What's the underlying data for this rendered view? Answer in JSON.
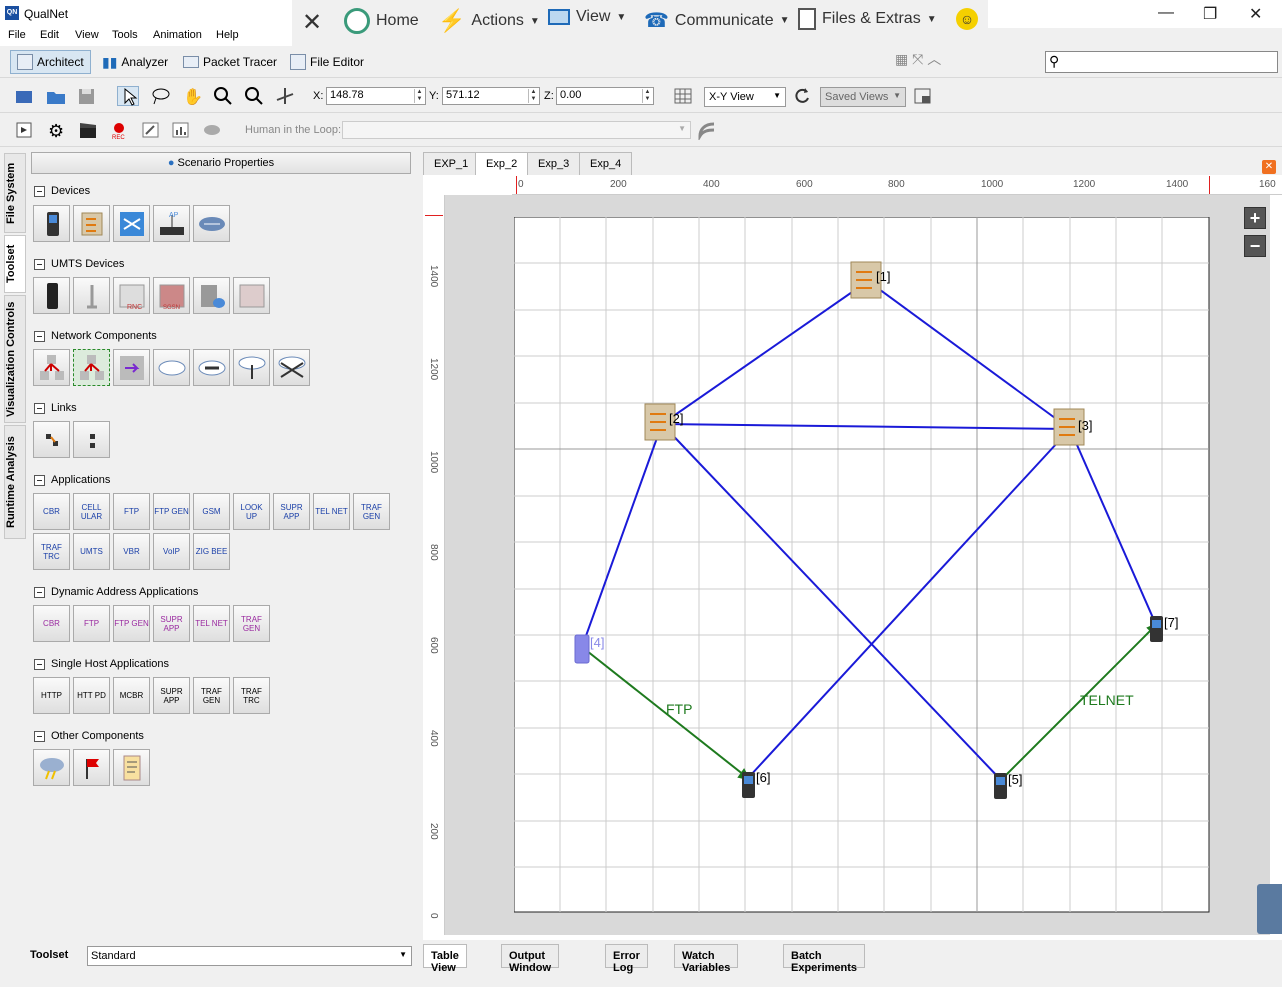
{
  "app": {
    "title": "QualNet"
  },
  "menu": [
    "File",
    "Edit",
    "View",
    "Tools",
    "Animation",
    "Help"
  ],
  "ribbon": {
    "home": "Home",
    "actions": "Actions",
    "view": "View",
    "communicate": "Communicate",
    "files": "Files & Extras"
  },
  "modes": [
    "Architect",
    "Analyzer",
    "Packet Tracer",
    "File Editor"
  ],
  "coords": {
    "x_label": "X:",
    "x": "148.78",
    "y_label": "Y:",
    "y": "571.12",
    "z_label": "Z:",
    "z": "0.00"
  },
  "view_select": "X-Y View",
  "saved_views": "Saved Views",
  "hitl_label": "Human in the Loop:",
  "side_tabs": [
    "File System",
    "Toolset",
    "Visualization Controls",
    "Runtime Analysis"
  ],
  "scenario_properties": "Scenario Properties",
  "sections": {
    "devices": "Devices",
    "umts": "UMTS Devices",
    "network": "Network Components",
    "links": "Links",
    "applications": "Applications",
    "dynamic": "Dynamic Address Applications",
    "single": "Single Host Applications",
    "other": "Other Components"
  },
  "umts_tile_labels": [
    "RNC",
    "SGSN"
  ],
  "applications": [
    "CBR",
    "CELL ULAR",
    "FTP",
    "FTP GEN",
    "GSM",
    "LOOK UP",
    "SUPR APP",
    "TEL NET",
    "TRAF GEN",
    "TRAF TRC",
    "UMTS",
    "VBR",
    "VoIP",
    "ZIG BEE"
  ],
  "dynamic_apps": [
    "CBR",
    "FTP",
    "FTP GEN",
    "SUPR APP",
    "TEL NET",
    "TRAF GEN"
  ],
  "single_host_apps": [
    "HTTP",
    "HTT PD",
    "MCBR",
    "SUPR APP",
    "TRAF GEN",
    "TRAF TRC"
  ],
  "toolset": {
    "label": "Toolset",
    "value": "Standard"
  },
  "exp_tabs": [
    "EXP_1",
    "Exp_2",
    "Exp_3",
    "Exp_4"
  ],
  "ruler_x": [
    "0",
    "200",
    "400",
    "600",
    "800",
    "1000",
    "1200",
    "1400",
    "160"
  ],
  "ruler_y": [
    "1400",
    "1200",
    "1000",
    "800",
    "600",
    "400",
    "200",
    "0"
  ],
  "bottom_tabs": [
    "Table View",
    "Output Window",
    "Error Log",
    "Watch Variables",
    "Batch Experiments"
  ],
  "nodes": [
    {
      "id": "[1]",
      "type": "router"
    },
    {
      "id": "[2]",
      "type": "router"
    },
    {
      "id": "[3]",
      "type": "router"
    },
    {
      "id": "[4]",
      "type": "phone-selected"
    },
    {
      "id": "[5]",
      "type": "phone"
    },
    {
      "id": "[6]",
      "type": "phone"
    },
    {
      "id": "[7]",
      "type": "phone"
    }
  ],
  "links": [
    [
      "[1]",
      "[2]"
    ],
    [
      "[1]",
      "[3]"
    ],
    [
      "[2]",
      "[3]"
    ],
    [
      "[2]",
      "[4]"
    ],
    [
      "[2]",
      "[5]"
    ],
    [
      "[3]",
      "[6]"
    ],
    [
      "[3]",
      "[7]"
    ]
  ],
  "apps_on_canvas": [
    {
      "label": "FTP",
      "from": "[4]",
      "to": "[6]"
    },
    {
      "label": "TELNET",
      "from": "[5]",
      "to": "[7]"
    }
  ],
  "colors": {
    "link": "#1a1ad8",
    "app": "#1e7a1e",
    "accent": "#1a4fa0"
  }
}
